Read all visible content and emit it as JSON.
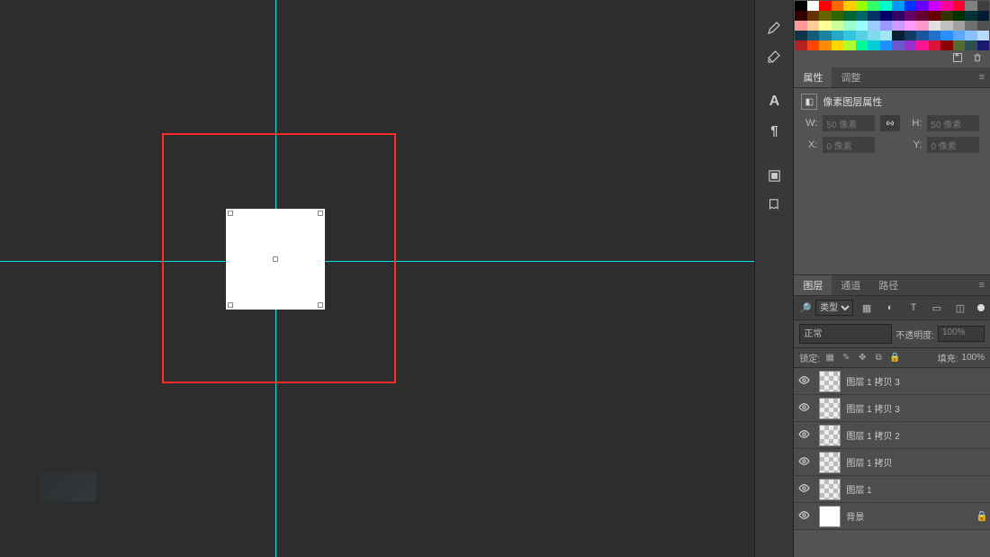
{
  "panels": {
    "properties": {
      "tab_active": "属性",
      "tab_other": "调整",
      "subtitle": "像素图层属性",
      "labels": {
        "w": "W:",
        "h": "H:",
        "x": "X:",
        "y": "Y:"
      },
      "values": {
        "w": "50 像素",
        "h": "50 像素",
        "x": "0 像素",
        "y": "0 像素"
      }
    },
    "layers": {
      "tab_active": "图层",
      "tab_channels": "通道",
      "tab_paths": "路径",
      "filter_kind": "类型",
      "blend_mode": "正常",
      "opacity_label": "不透明度:",
      "opacity_value": "100%",
      "lock_label": "锁定:",
      "fill_label": "填充:",
      "fill_value": "100%",
      "items": [
        {
          "name": "图层 1 拷贝 3",
          "thumb": "chk",
          "locked": false
        },
        {
          "name": "图层 1 拷贝 3",
          "thumb": "chk",
          "locked": false
        },
        {
          "name": "图层 1 拷贝 2",
          "thumb": "chk",
          "locked": false
        },
        {
          "name": "图层 1 拷贝",
          "thumb": "chk",
          "locked": false
        },
        {
          "name": "图层 1",
          "thumb": "chk",
          "locked": false
        },
        {
          "name": "背景",
          "thumb": "white",
          "locked": true
        }
      ]
    }
  },
  "swatches": [
    "#000000",
    "#ffffff",
    "#ff0000",
    "#ff6600",
    "#ffcc00",
    "#99ff00",
    "#33ff66",
    "#00ffcc",
    "#0099ff",
    "#0033ff",
    "#6600ff",
    "#cc00ff",
    "#ff0099",
    "#ff0033",
    "#808080",
    "#404040",
    "#330000",
    "#663300",
    "#666600",
    "#336600",
    "#006633",
    "#006666",
    "#003366",
    "#000066",
    "#330066",
    "#660066",
    "#660033",
    "#660000",
    "#333300",
    "#003300",
    "#003333",
    "#001a33",
    "#ff9999",
    "#ffcc99",
    "#ffff99",
    "#ccff99",
    "#99ffcc",
    "#99ffff",
    "#99ccff",
    "#9999ff",
    "#cc99ff",
    "#ff99ff",
    "#ff99cc",
    "#e0e0e0",
    "#c0c0c0",
    "#a0a0a0",
    "#707070",
    "#505050",
    "#0f354a",
    "#155d76",
    "#1c84a1",
    "#26a9c9",
    "#35c4de",
    "#58d0e6",
    "#7cdcee",
    "#a0e7f5",
    "#0a1e33",
    "#123a66",
    "#1a5699",
    "#2272cc",
    "#2a8eff",
    "#5aa8ff",
    "#89c1ff",
    "#b8daff",
    "#b22222",
    "#ff4500",
    "#ff8c00",
    "#ffd700",
    "#adff2f",
    "#00fa9a",
    "#00ced1",
    "#1e90ff",
    "#6a5acd",
    "#9932cc",
    "#ff1493",
    "#dc143c",
    "#8b0000",
    "#556b2f",
    "#2f4f4f",
    "#191970"
  ]
}
